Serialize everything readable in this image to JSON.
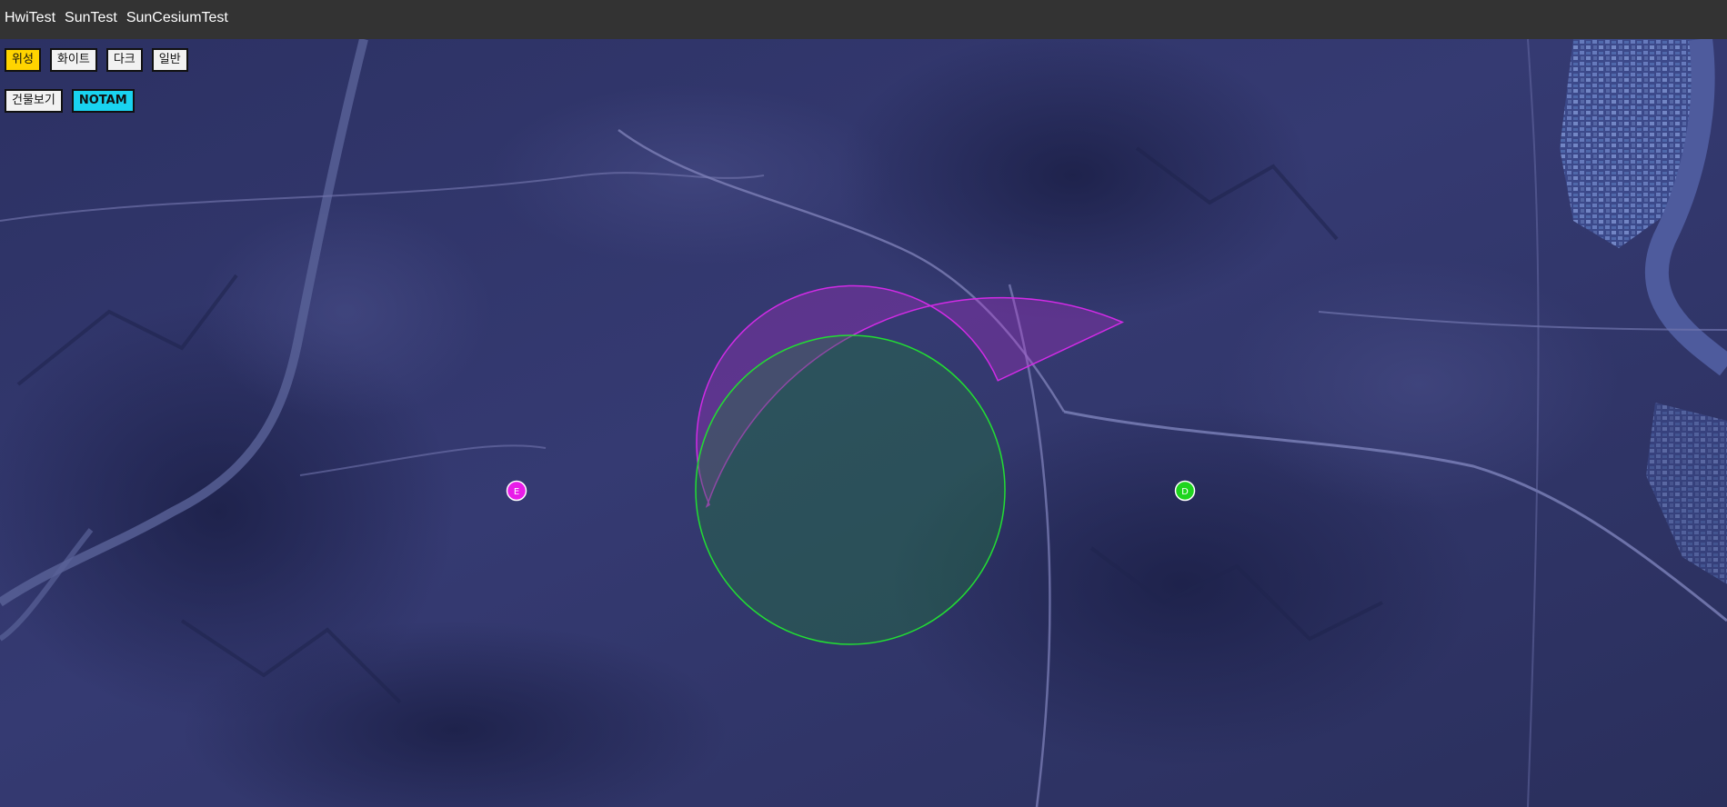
{
  "nav": {
    "items": [
      "HwiTest",
      "SunTest",
      "SunCesiumTest"
    ]
  },
  "map_style_buttons": [
    {
      "label": "위성",
      "active": true
    },
    {
      "label": "화이트",
      "active": false
    },
    {
      "label": "다크",
      "active": false
    },
    {
      "label": "일반",
      "active": false
    }
  ],
  "layer_buttons": {
    "buildings": "건물보기",
    "notam": "NOTAM"
  },
  "markers": {
    "e": {
      "label": "E",
      "color": "#e81ce8"
    },
    "d": {
      "label": "D",
      "color": "#1ed51e"
    }
  },
  "overlays": {
    "sector_color": "#c52bd9",
    "circle_color": "#22cc33"
  }
}
